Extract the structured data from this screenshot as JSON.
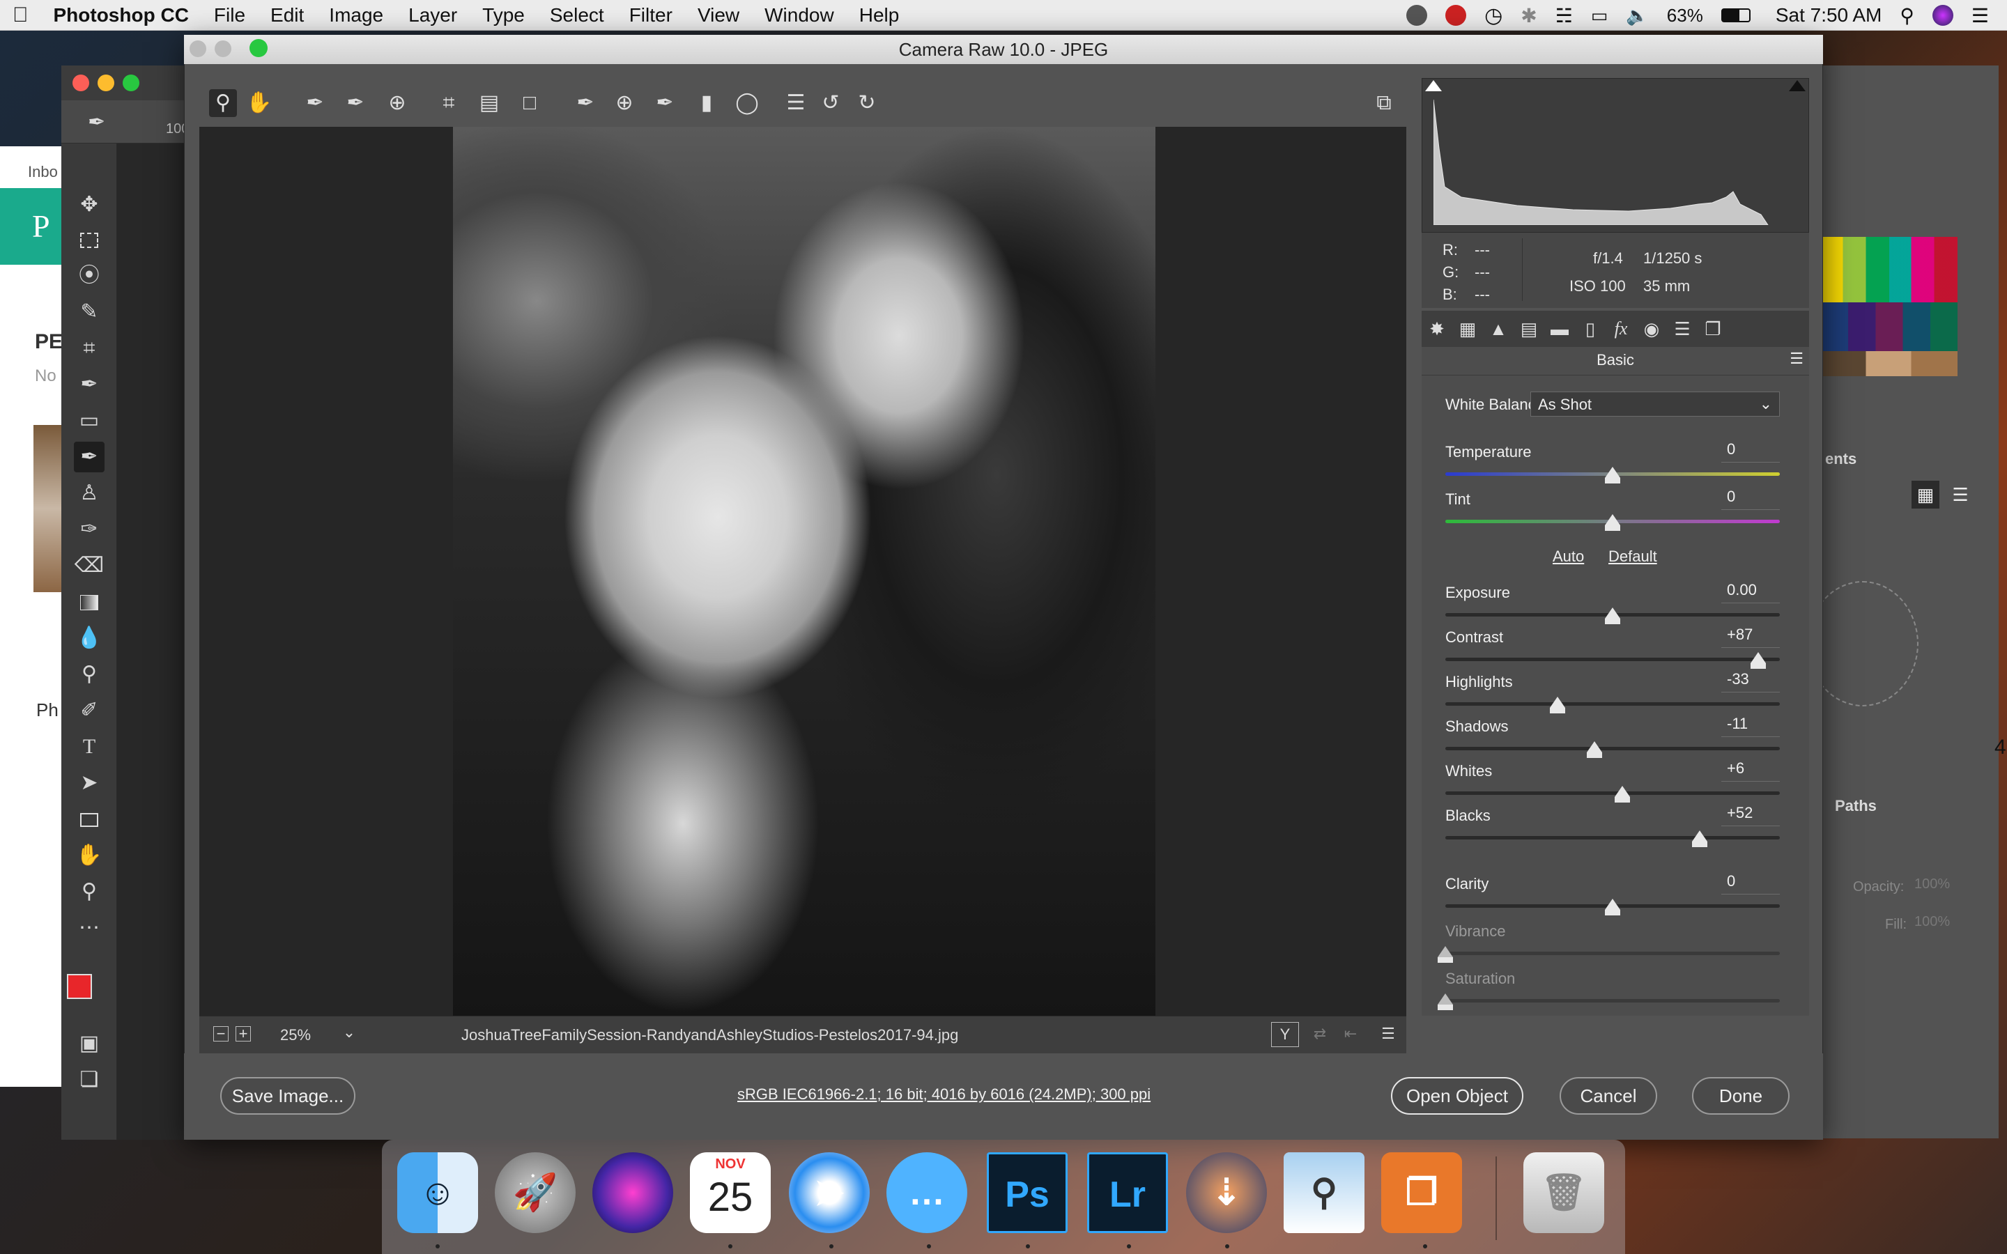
{
  "menubar": {
    "apple": "",
    "app": "Photoshop CC",
    "items": [
      "File",
      "Edit",
      "Image",
      "Layer",
      "Type",
      "Select",
      "Filter",
      "View",
      "Window",
      "Help"
    ],
    "battery": "63%",
    "clock": "Sat 7:50 AM"
  },
  "photoshop": {
    "brush_size": "100",
    "browser_tab": "Inbo",
    "browser_heading": "PE",
    "browser_sub": "No",
    "browser_ph": "Ph",
    "panel_ents": "ents",
    "panel_paths": "Paths",
    "panel_opacity_label": "Opacity:",
    "panel_opacity_value": "100%",
    "panel_fill_label": "Fill:",
    "panel_fill_value": "100%",
    "edge_digit": "4"
  },
  "camera_raw": {
    "title": "Camera Raw 10.0  -  JPEG",
    "rgb": {
      "r_label": "R:",
      "r": "---",
      "g_label": "G:",
      "g": "---",
      "b_label": "B:",
      "b": "---"
    },
    "exif": {
      "aperture": "f/1.4",
      "shutter": "1/1250 s",
      "iso": "ISO 100",
      "focal": "35 mm"
    },
    "panel_title": "Basic",
    "white_balance_label": "White Balance:",
    "white_balance_value": "As Shot",
    "auto_label": "Auto",
    "default_label": "Default",
    "sliders": [
      {
        "label": "Temperature",
        "value": "0",
        "position": 0.5
      },
      {
        "label": "Tint",
        "value": "0",
        "position": 0.5
      },
      {
        "label": "Exposure",
        "value": "0.00",
        "position": 0.5
      },
      {
        "label": "Contrast",
        "value": "+87",
        "position": 0.935
      },
      {
        "label": "Highlights",
        "value": "-33",
        "position": 0.335
      },
      {
        "label": "Shadows",
        "value": "-11",
        "position": 0.445
      },
      {
        "label": "Whites",
        "value": "+6",
        "position": 0.53
      },
      {
        "label": "Blacks",
        "value": "+52",
        "position": 0.76
      },
      {
        "label": "Clarity",
        "value": "0",
        "position": 0.5
      },
      {
        "label": "Vibrance",
        "value": "",
        "position": 0.0
      },
      {
        "label": "Saturation",
        "value": "",
        "position": 0.0
      }
    ],
    "zoom": "25%",
    "filename": "JoshuaTreeFamilySession-RandyandAshleyStudios-Pestelos2017-94.jpg",
    "workflow": "sRGB IEC61966-2.1; 16 bit; 4016 by 6016 (24.2MP); 300 ppi",
    "buttons": {
      "save": "Save Image...",
      "open": "Open Object",
      "cancel": "Cancel",
      "done": "Done"
    }
  },
  "dock": {
    "calendar_month": "NOV",
    "calendar_day": "25",
    "ps": "Ps",
    "lr": "Lr"
  },
  "colors": {
    "accent_teal": "#1aaa8c",
    "foreground_swatch": "#e8262a",
    "dialog_bg": "#535353"
  }
}
